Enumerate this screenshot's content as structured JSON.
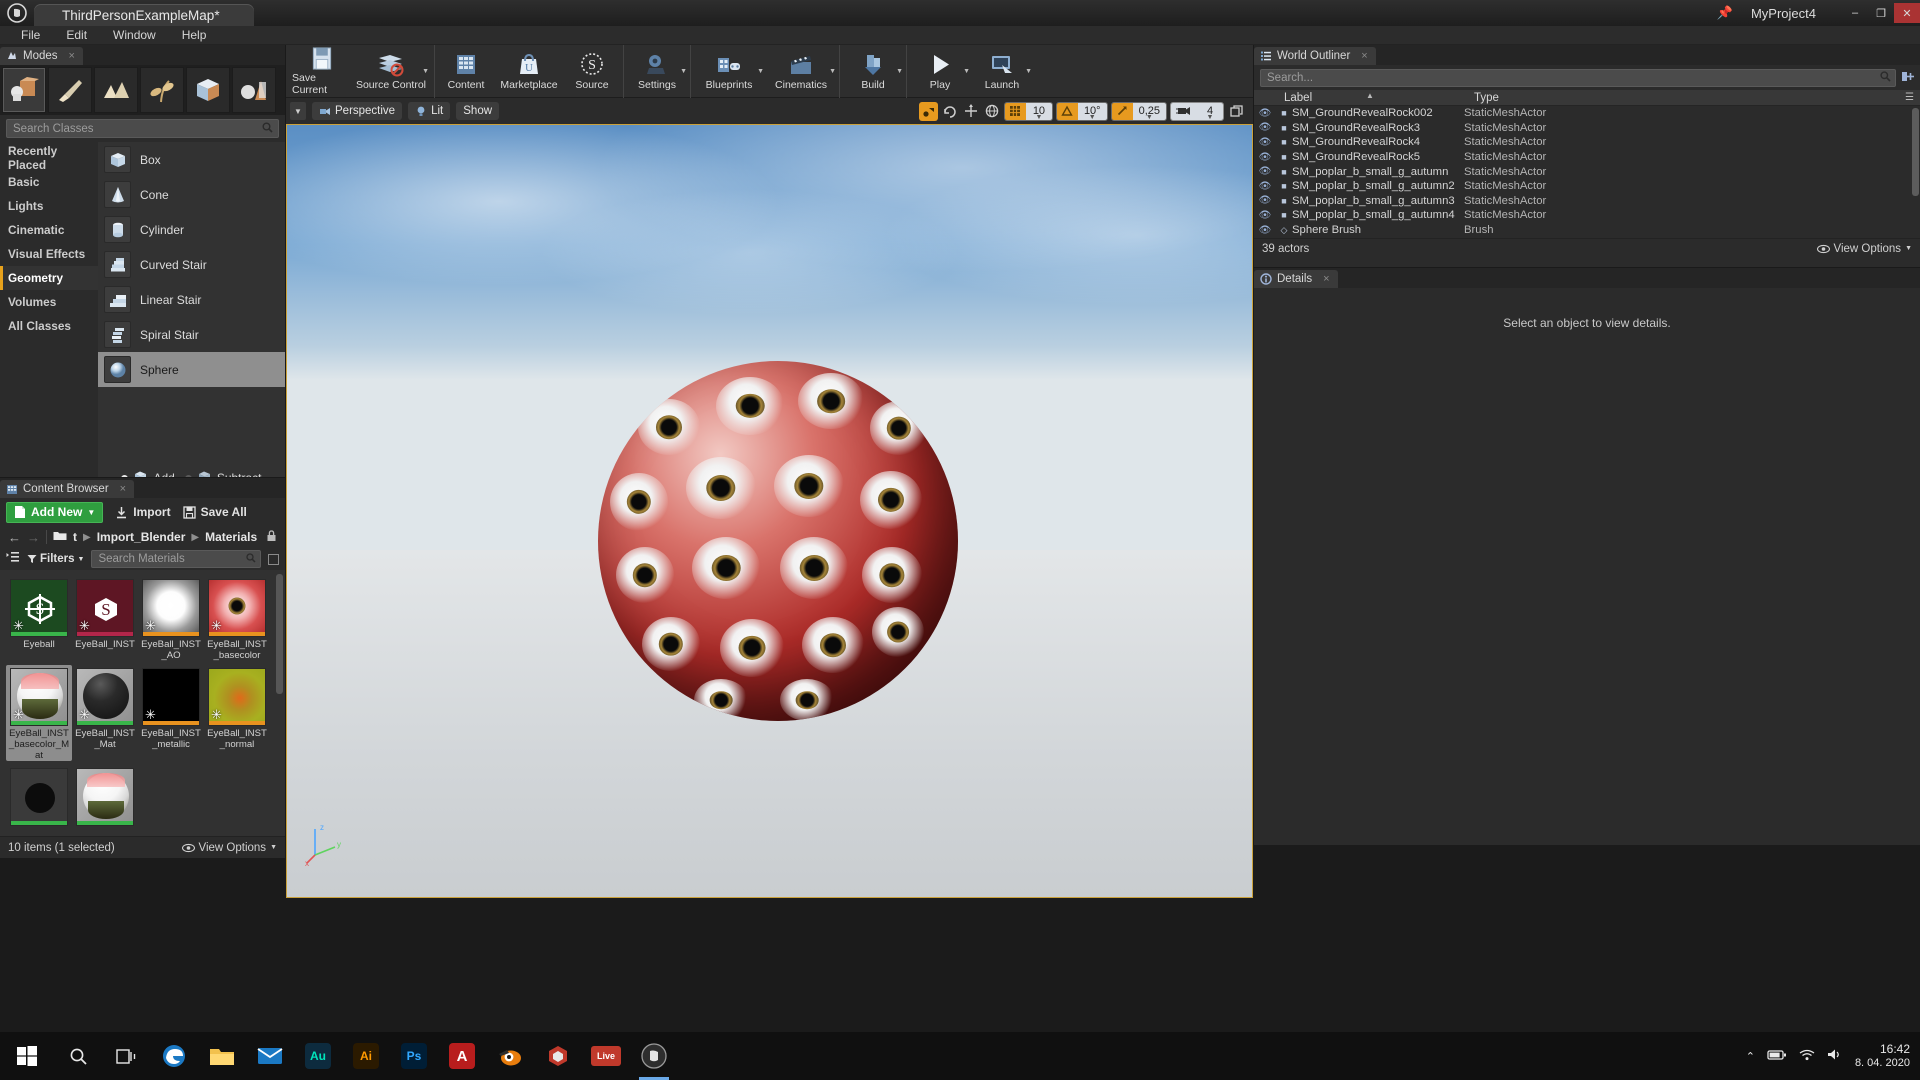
{
  "titlebar": {
    "logo": "ue-logo-icon",
    "map_tab": "ThirdPersonExampleMap*",
    "project_name": "MyProject4",
    "pin_icon": "pin-icon",
    "minimize": "–",
    "maximize": "❐",
    "close": "✕"
  },
  "menu": {
    "items": [
      "File",
      "Edit",
      "Window",
      "Help"
    ]
  },
  "modes": {
    "tab_label": "Modes",
    "tab_icon": "modes-icon",
    "close_icon": "×",
    "buttons": [
      {
        "name": "place-mode",
        "icon": "place-icon",
        "selected": true
      },
      {
        "name": "paint-mode",
        "icon": "brush-icon",
        "selected": false
      },
      {
        "name": "landscape-mode",
        "icon": "landscape-icon",
        "selected": false
      },
      {
        "name": "foliage-mode",
        "icon": "foliage-icon",
        "selected": false
      },
      {
        "name": "geometry-editing-mode",
        "icon": "geometry-edit-icon",
        "selected": false
      },
      {
        "name": "mesh-paint-mode",
        "icon": "cone-sphere-icon",
        "selected": false
      }
    ],
    "search_placeholder": "Search Classes",
    "categories": [
      {
        "label": "Recently Placed",
        "active": false
      },
      {
        "label": "Basic",
        "active": false
      },
      {
        "label": "Lights",
        "active": false
      },
      {
        "label": "Cinematic",
        "active": false
      },
      {
        "label": "Visual Effects",
        "active": false
      },
      {
        "label": "Geometry",
        "active": true
      },
      {
        "label": "Volumes",
        "active": false
      },
      {
        "label": "All Classes",
        "active": false
      }
    ],
    "classes": [
      {
        "label": "Box",
        "selected": false
      },
      {
        "label": "Cone",
        "selected": false
      },
      {
        "label": "Cylinder",
        "selected": false
      },
      {
        "label": "Curved Stair",
        "selected": false
      },
      {
        "label": "Linear Stair",
        "selected": false
      },
      {
        "label": "Spiral Stair",
        "selected": false
      },
      {
        "label": "Sphere",
        "selected": true
      }
    ],
    "brush_mode": {
      "add_label": "Add",
      "subtract_label": "Subtract",
      "selected": "Add"
    }
  },
  "toolbar": {
    "items": [
      {
        "label": "Save Current",
        "icon": "save-icon",
        "has_dropdown": false
      },
      {
        "label": "Source Control",
        "icon": "source-control-icon",
        "has_dropdown": true
      },
      {
        "label": "Content",
        "icon": "content-icon",
        "has_dropdown": false
      },
      {
        "label": "Marketplace",
        "icon": "marketplace-icon",
        "has_dropdown": false
      },
      {
        "label": "Source",
        "icon": "source-icon",
        "has_dropdown": false
      },
      {
        "label": "Settings",
        "icon": "settings-icon",
        "has_dropdown": true
      },
      {
        "label": "Blueprints",
        "icon": "blueprints-icon",
        "has_dropdown": true
      },
      {
        "label": "Cinematics",
        "icon": "cinematics-icon",
        "has_dropdown": true
      },
      {
        "label": "Build",
        "icon": "build-icon",
        "has_dropdown": true
      },
      {
        "label": "Play",
        "icon": "play-icon",
        "has_dropdown": true
      },
      {
        "label": "Launch",
        "icon": "launch-icon",
        "has_dropdown": true
      }
    ]
  },
  "viewport": {
    "perspective_label": "Perspective",
    "lighting_label": "Lit",
    "show_label": "Show",
    "snap_surface_icon": "surface-snap-icon",
    "rotation_lock_icon": "rotation-lock-icon",
    "world_icon": "world-icon",
    "grid_snap_value": "10",
    "rotation_snap_value": "10°",
    "scale_snap_value": "0,25",
    "camera_speed_value": "4",
    "maximize_icon": "maximize-viewport-icon",
    "axis_labels": [
      "z",
      "y",
      "x"
    ]
  },
  "content_browser": {
    "tab_label": "Content Browser",
    "tab_icon": "content-browser-icon",
    "close_icon": "×",
    "add_new_label": "Add New",
    "import_label": "Import",
    "save_all_label": "Save All",
    "breadcrumb": [
      "t",
      "Import_Blender",
      "Materials"
    ],
    "filters_label": "Filters",
    "search_placeholder": "Search Materials",
    "assets": [
      {
        "label": "Eyeball",
        "kind": "material",
        "strip": "#39b54a",
        "bg": "#1c4a20",
        "selected": false,
        "glyph": "S",
        "dirty": true
      },
      {
        "label": "EyeBall_INST",
        "kind": "material-instance",
        "strip": "#b3264a",
        "bg": "#5e1624",
        "selected": false,
        "glyph": "S",
        "dirty": true
      },
      {
        "label": "EyeBall_INST_AO",
        "kind": "texture",
        "strip": "#e8921f",
        "bg": "#4a4a4a",
        "selected": false,
        "glyph": "",
        "dirty": true
      },
      {
        "label": "EyeBall_INST_basecolor",
        "kind": "texture",
        "strip": "#e8921f",
        "bg": "#e8a0a0",
        "selected": false,
        "glyph": "",
        "dirty": true
      },
      {
        "label": "EyeBall_INST_basecolor_Mat",
        "kind": "material",
        "strip": "#39b54a",
        "bg": "#8a8a8a",
        "selected": true,
        "glyph": "",
        "dirty": true
      },
      {
        "label": "EyeBall_INST_Mat",
        "kind": "material",
        "strip": "#39b54a",
        "bg": "#8a8a8a",
        "selected": false,
        "glyph": "",
        "dirty": true
      },
      {
        "label": "EyeBall_INST_metallic",
        "kind": "texture",
        "strip": "#e8921f",
        "bg": "#000000",
        "selected": false,
        "glyph": "",
        "dirty": true
      },
      {
        "label": "EyeBall_INST_normal",
        "kind": "texture",
        "strip": "#e8921f",
        "bg": "#b3b31a",
        "selected": false,
        "glyph": "",
        "dirty": true
      },
      {
        "label": "",
        "kind": "material",
        "strip": "#39b54a",
        "bg": "#3a3a3a",
        "selected": false,
        "glyph": "",
        "dirty": false
      },
      {
        "label": "",
        "kind": "material",
        "strip": "#39b54a",
        "bg": "#8a8a8a",
        "selected": false,
        "glyph": "",
        "dirty": false
      }
    ],
    "status": "10 items (1 selected)",
    "view_options_label": "View Options"
  },
  "outliner": {
    "tab_label": "World Outliner",
    "tab_icon": "outliner-icon",
    "close_icon": "×",
    "search_placeholder": "Search...",
    "column_label": "Label",
    "column_type": "Type",
    "rows": [
      {
        "label": "SM_GroundRevealRock002",
        "type": "StaticMeshActor"
      },
      {
        "label": "SM_GroundRevealRock3",
        "type": "StaticMeshActor"
      },
      {
        "label": "SM_GroundRevealRock4",
        "type": "StaticMeshActor"
      },
      {
        "label": "SM_GroundRevealRock5",
        "type": "StaticMeshActor"
      },
      {
        "label": "SM_poplar_b_small_g_autumn",
        "type": "StaticMeshActor"
      },
      {
        "label": "SM_poplar_b_small_g_autumn2",
        "type": "StaticMeshActor"
      },
      {
        "label": "SM_poplar_b_small_g_autumn3",
        "type": "StaticMeshActor"
      },
      {
        "label": "SM_poplar_b_small_g_autumn4",
        "type": "StaticMeshActor"
      },
      {
        "label": "Sphere Brush",
        "type": "Brush"
      }
    ],
    "status": "39 actors",
    "view_options_label": "View Options"
  },
  "details": {
    "tab_label": "Details",
    "tab_icon": "details-icon",
    "close_icon": "×",
    "empty_message": "Select an object to view details."
  },
  "taskbar": {
    "start_icon": "windows-start-icon",
    "items": [
      {
        "name": "search-icon",
        "glyph": "○",
        "color": "transparent",
        "text": "⚲"
      },
      {
        "name": "task-view-icon",
        "glyph": "",
        "color": "transparent",
        "text": "❑"
      },
      {
        "name": "edge-icon",
        "glyph": "e",
        "color": "#2a7ac0",
        "text": "e"
      },
      {
        "name": "file-explorer-icon",
        "glyph": "",
        "color": "#e8b33a",
        "text": "▭"
      },
      {
        "name": "mail-icon",
        "glyph": "",
        "color": "#2a7ac0",
        "text": "✉"
      },
      {
        "name": "audition-icon",
        "glyph": "Au",
        "color": "#0d2b3e",
        "text": "Au"
      },
      {
        "name": "illustrator-icon",
        "glyph": "Ai",
        "color": "#2b1a00",
        "text": "Ai"
      },
      {
        "name": "photoshop-icon",
        "glyph": "Ps",
        "color": "#001e36",
        "text": "Ps"
      },
      {
        "name": "acrobat-icon",
        "glyph": "A",
        "color": "#b81d1d",
        "text": "A"
      },
      {
        "name": "blender-icon",
        "glyph": "",
        "color": "#e87d0d",
        "text": "◐"
      },
      {
        "name": "unity-hub-icon",
        "glyph": "",
        "color": "#c0392b",
        "text": "◆"
      },
      {
        "name": "live-icon",
        "glyph": "Live",
        "color": "#c0392b",
        "text": "Live"
      },
      {
        "name": "unreal-engine-icon",
        "glyph": "",
        "color": "#3a3a3a",
        "text": "Ⓤ",
        "active": true
      }
    ],
    "tray": {
      "chevron": "⌃",
      "battery_icon": "battery-icon",
      "network_icon": "network-icon",
      "volume_icon": "volume-icon",
      "time": "16:42",
      "date": "8. 04. 2020"
    }
  },
  "colors": {
    "accent_orange": "#e8a21c",
    "green_button": "#2f9e3f",
    "panel_bg": "#2b2b2b",
    "viewport_border": "#caa13a"
  }
}
